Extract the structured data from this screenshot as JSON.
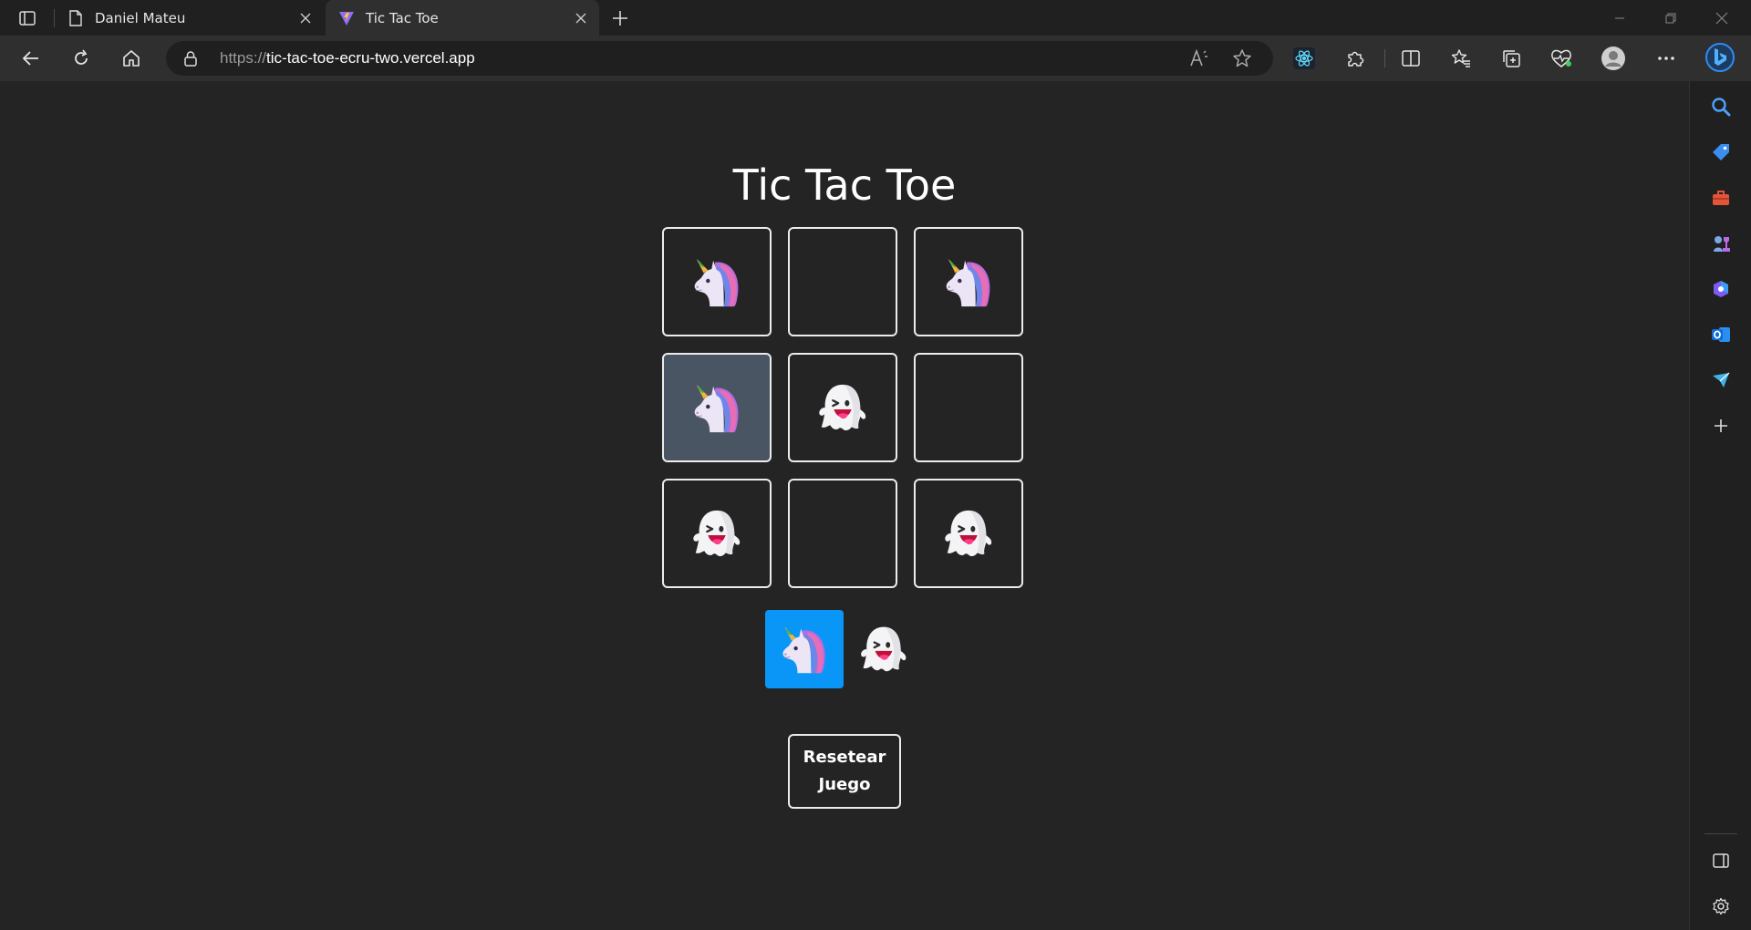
{
  "browser": {
    "tabs": [
      {
        "title": "Daniel Mateu",
        "active": false
      },
      {
        "title": "Tic Tac Toe",
        "active": true
      }
    ],
    "url_prefix": "https://",
    "url_host": "tic-tac-toe-ecru-two.vercel.app"
  },
  "game": {
    "title": "Tic Tac Toe",
    "board": [
      "unicorn",
      "",
      "unicorn",
      "unicorn",
      "ghost",
      "",
      "ghost",
      "",
      "ghost"
    ],
    "highlighted_cell": 3,
    "turn_players": [
      "unicorn",
      "ghost"
    ],
    "current_turn": "unicorn",
    "reset_line1": "Resetear",
    "reset_line2": "Juego"
  },
  "colors": {
    "page_bg": "#242424",
    "turn_active": "#0a96f6",
    "highlight_cell": "#4a5564"
  }
}
